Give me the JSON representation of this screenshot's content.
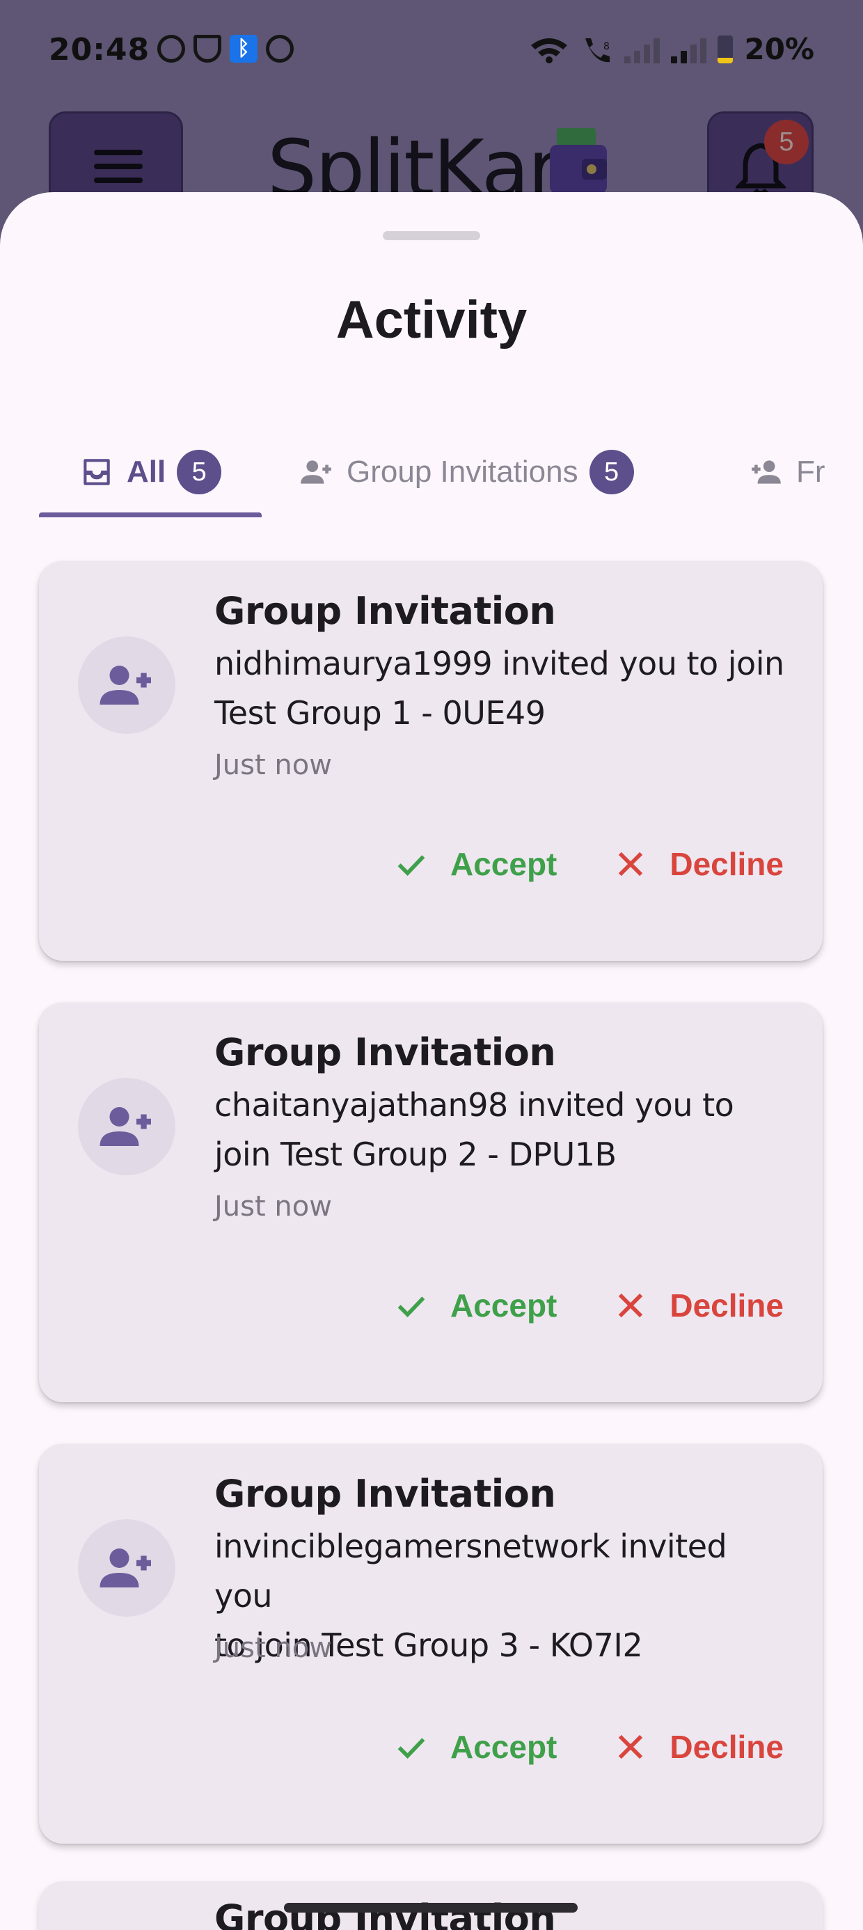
{
  "status_bar": {
    "time": "20:48",
    "battery": "20%",
    "battery_level": 0.2,
    "app_icons": [
      "whatsapp-icon",
      "vpn-icon",
      "bluetooth-icon",
      "browser-icon"
    ]
  },
  "app_bar": {
    "title": "SplitKar",
    "notification_count": "5"
  },
  "sheet": {
    "title": "Activity",
    "tabs": [
      {
        "label": "All",
        "badge": "5",
        "active": true
      },
      {
        "label": "Group Invitations",
        "badge": "5",
        "active": false
      },
      {
        "label": "Fr",
        "badge": "",
        "active": false
      }
    ]
  },
  "cards": [
    {
      "title": "Group Invitation",
      "line1": "nidhimaurya1999 invited you to join",
      "line2": "Test Group 1 - 0UE49",
      "time": "Just now",
      "accept": "Accept",
      "decline": "Decline"
    },
    {
      "title": "Group Invitation",
      "line1": "chaitanyajathan98 invited you to",
      "line2": "join Test Group 2 - DPU1B",
      "time": "Just now",
      "accept": "Accept",
      "decline": "Decline"
    },
    {
      "title": "Group Invitation",
      "line1": "invinciblegamersnetwork invited you",
      "line2": "to join Test Group 3 - KO7I2",
      "time": "Just now",
      "accept": "Accept",
      "decline": "Decline"
    },
    {
      "title": "Group Invitation"
    }
  ],
  "colors": {
    "accent": "#5d4e8c",
    "accept": "#3fa04a",
    "decline": "#d9453d",
    "sheet_bg": "#fdf7fd",
    "card_bg": "#eee7f0"
  }
}
